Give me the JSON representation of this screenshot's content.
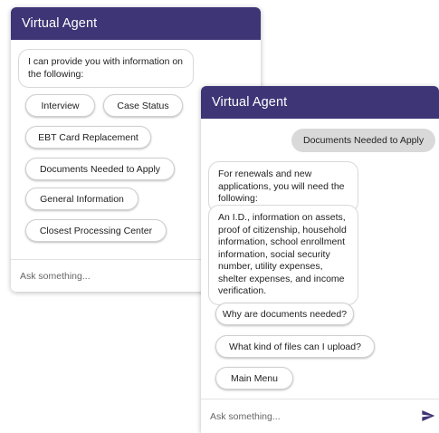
{
  "window_left": {
    "title": "Virtual Agent",
    "bot_message": "I can provide you with information on the following:",
    "options": [
      "Interview",
      "Case Status",
      "EBT Card Replacement",
      "Documents Needed to Apply",
      "General Information",
      "Closest Processing Center"
    ],
    "input_placeholder": "Ask something..."
  },
  "window_right": {
    "title": "Virtual Agent",
    "user_message": "Documents Needed to Apply",
    "bot_messages": [
      "For renewals and new applications, you will need the following:",
      "An I.D., information on assets, proof of citizenship, household information, school enrollment information, social security number, utility expenses, shelter expenses, and income verification."
    ],
    "options": [
      "Why are documents needed?",
      "What kind of files can I upload?",
      "Main Menu"
    ],
    "input_placeholder": "Ask something...",
    "send_icon": "send-icon"
  },
  "colors": {
    "header": "#3d3576",
    "user_bubble": "#d9d9d9",
    "send_icon": "#3d3576"
  }
}
